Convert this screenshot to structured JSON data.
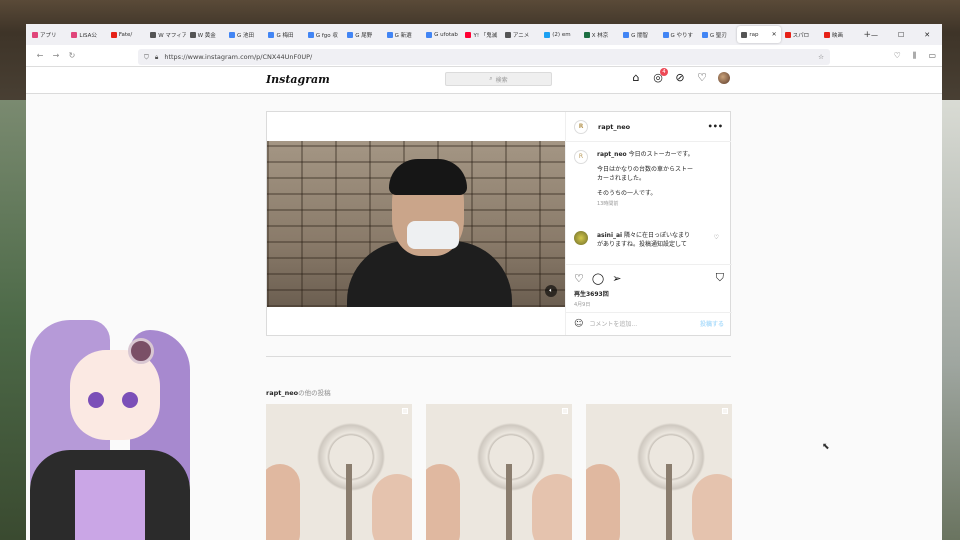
{
  "tabs": [
    {
      "label": "アプリ",
      "color": "#e0457a"
    },
    {
      "label": "LiSA公",
      "color": "#e0457a"
    },
    {
      "label": "Fate/",
      "color": "#e62117"
    },
    {
      "label": "W マフィア",
      "color": "#555555"
    },
    {
      "label": "W 黄金",
      "color": "#555555"
    },
    {
      "label": "G 池田",
      "color": "#4285f4"
    },
    {
      "label": "G 梅田",
      "color": "#4285f4"
    },
    {
      "label": "G fgo 収",
      "color": "#4285f4"
    },
    {
      "label": "G 尾野",
      "color": "#4285f4"
    },
    {
      "label": "G 新選",
      "color": "#4285f4"
    },
    {
      "label": "G ufotab",
      "color": "#4285f4"
    },
    {
      "label": "Y! 「鬼滅",
      "color": "#ff0033"
    },
    {
      "label": "アニメ",
      "color": "#555555"
    },
    {
      "label": "(2) em",
      "color": "#1da1f2"
    },
    {
      "label": "X 林京",
      "color": "#1d6f42"
    },
    {
      "label": "G 闇智",
      "color": "#4285f4"
    },
    {
      "label": "G やりす",
      "color": "#4285f4"
    },
    {
      "label": "G 聖刃",
      "color": "#4285f4"
    }
  ],
  "active_tab": {
    "label": "rap",
    "close": "✕"
  },
  "extra_tabs": [
    {
      "label": "スパロ",
      "color": "#e62117"
    },
    {
      "label": "映画",
      "color": "#e62117"
    }
  ],
  "new_tab": "+",
  "window_controls": {
    "minimize": "—",
    "maximize": "☐",
    "close": "✕"
  },
  "url": "https://www.instagram.com/p/CNX44UnF0UP/",
  "instagram": {
    "logo": "Instagram",
    "search_placeholder": "検索",
    "notification_count": "4",
    "post": {
      "username": "rapt_neo",
      "caption_user": "rapt_neo",
      "caption_lines": [
        "今日のストーカーです。",
        "",
        "今日はかなりの台数の車からストー",
        "カーされました。",
        "",
        "そのうちの一人です。"
      ],
      "caption_time": "13時間前",
      "comment_user": "asini_ai",
      "comment_text": "隣々に在日っぽいなまり",
      "comment_text2": "がありますね。投稿通知設定して",
      "views": "再生3693回",
      "date": "4月9日",
      "add_comment_placeholder": "コメントを追加...",
      "post_button": "投稿する"
    },
    "more_posts_user": "rapt_neo",
    "more_posts_suffix": "の他の投稿"
  }
}
